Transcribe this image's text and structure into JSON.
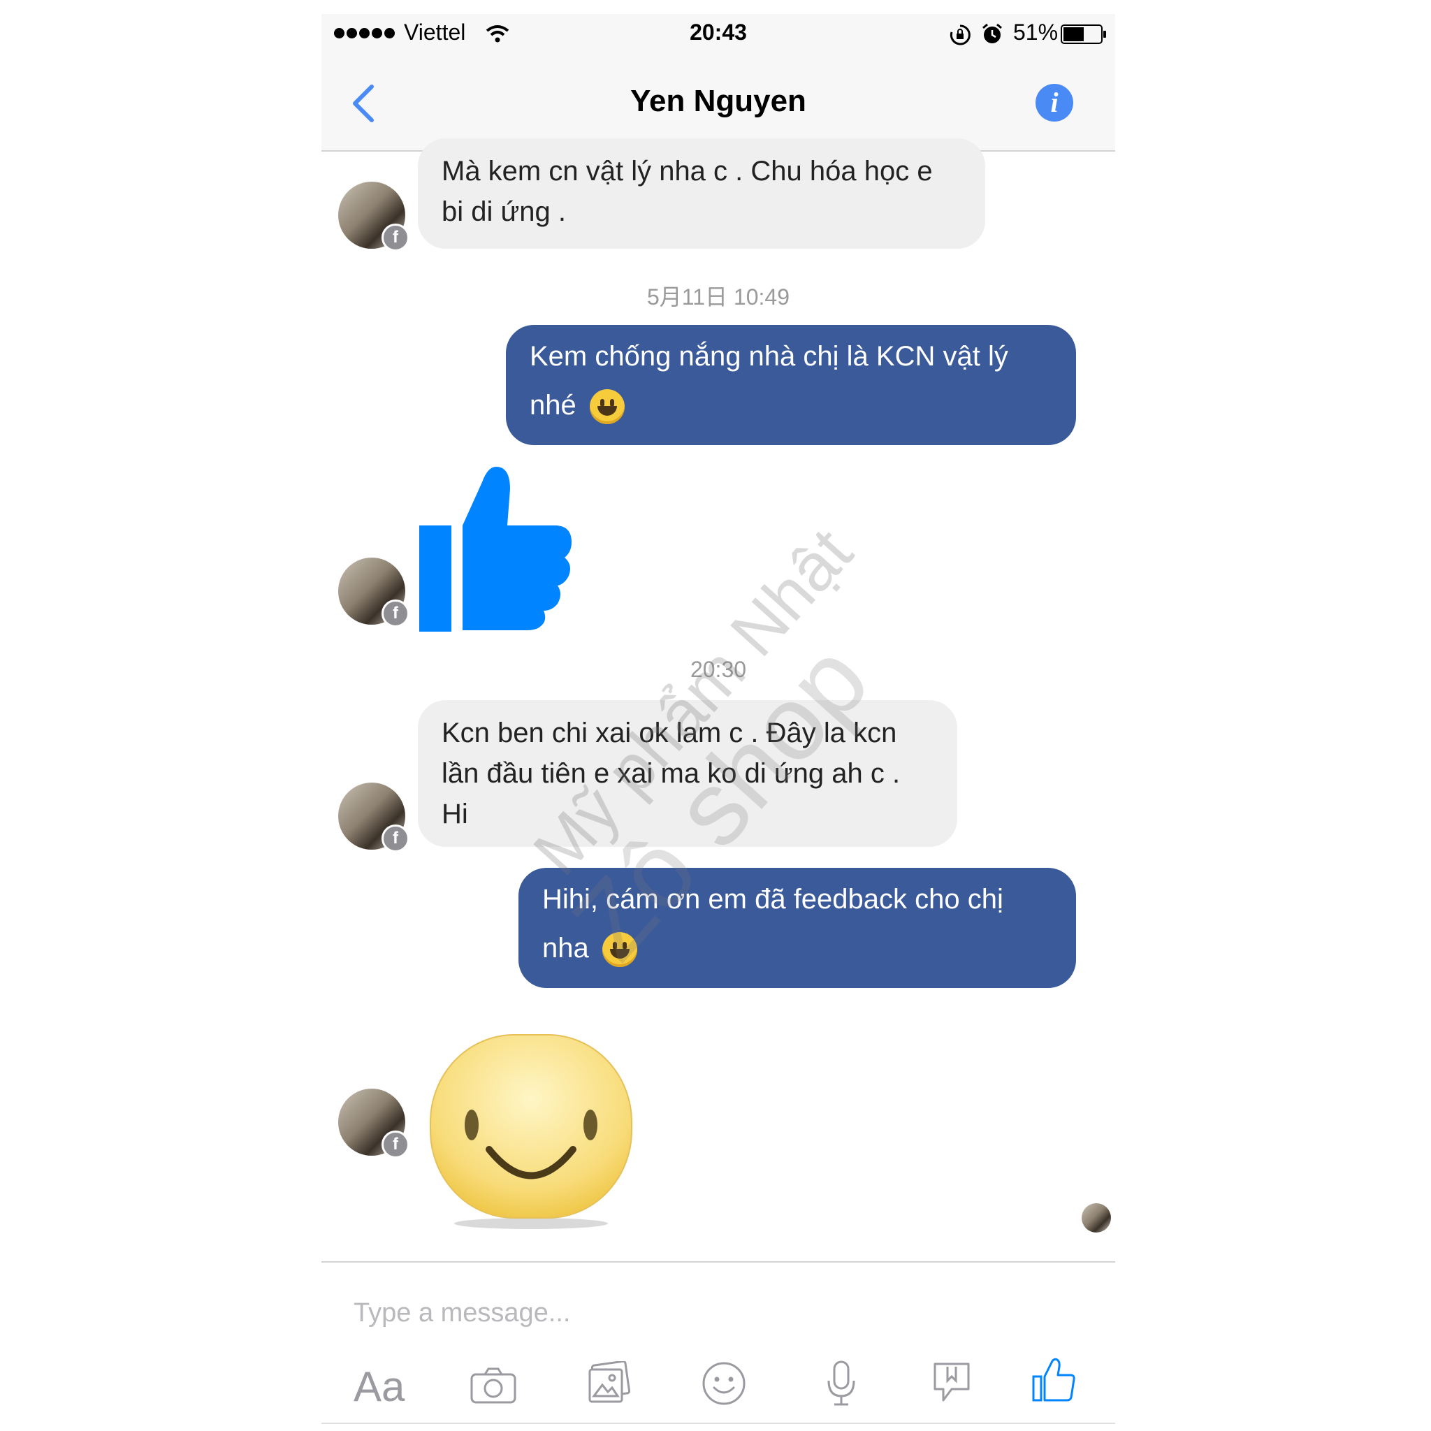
{
  "status_bar": {
    "carrier": "Viettel",
    "time": "20:43",
    "battery_percent": "51%"
  },
  "header": {
    "contact_name": "Yen Nguyen",
    "info_label": "i"
  },
  "messages": {
    "m1": "Mà kem cn vật lý nha c . Chu hóa học e bi di ứng .",
    "ts1": "5月11日 10:49",
    "m2": "Kem chống nắng nhà chị là KCN vật lý nhé",
    "ts2": "20:30",
    "m3": "Kcn ben chi xai ok lam c . Đây la kcn lần đầu tiên e xai ma ko di ứng ah c . Hi",
    "m4": "Hihi, cám ơn em đã feedback cho chị nha"
  },
  "watermark": {
    "line1": "Mỹ phẩm Nhật",
    "line2": "Zô shop"
  },
  "composer": {
    "placeholder": "Type a message...",
    "text_tool_label": "Aa"
  },
  "colors": {
    "outgoing_bubble": "#3b5a9a",
    "incoming_bubble": "#efefef",
    "messenger_blue": "#0084ff",
    "accent": "#4a8af4"
  },
  "icons": [
    "back-chevron-icon",
    "info-icon",
    "thumbs-up-icon",
    "smiley-sticker-icon",
    "camera-icon",
    "gallery-icon",
    "emoji-icon",
    "microphone-icon",
    "location-icon",
    "like-button-icon"
  ]
}
